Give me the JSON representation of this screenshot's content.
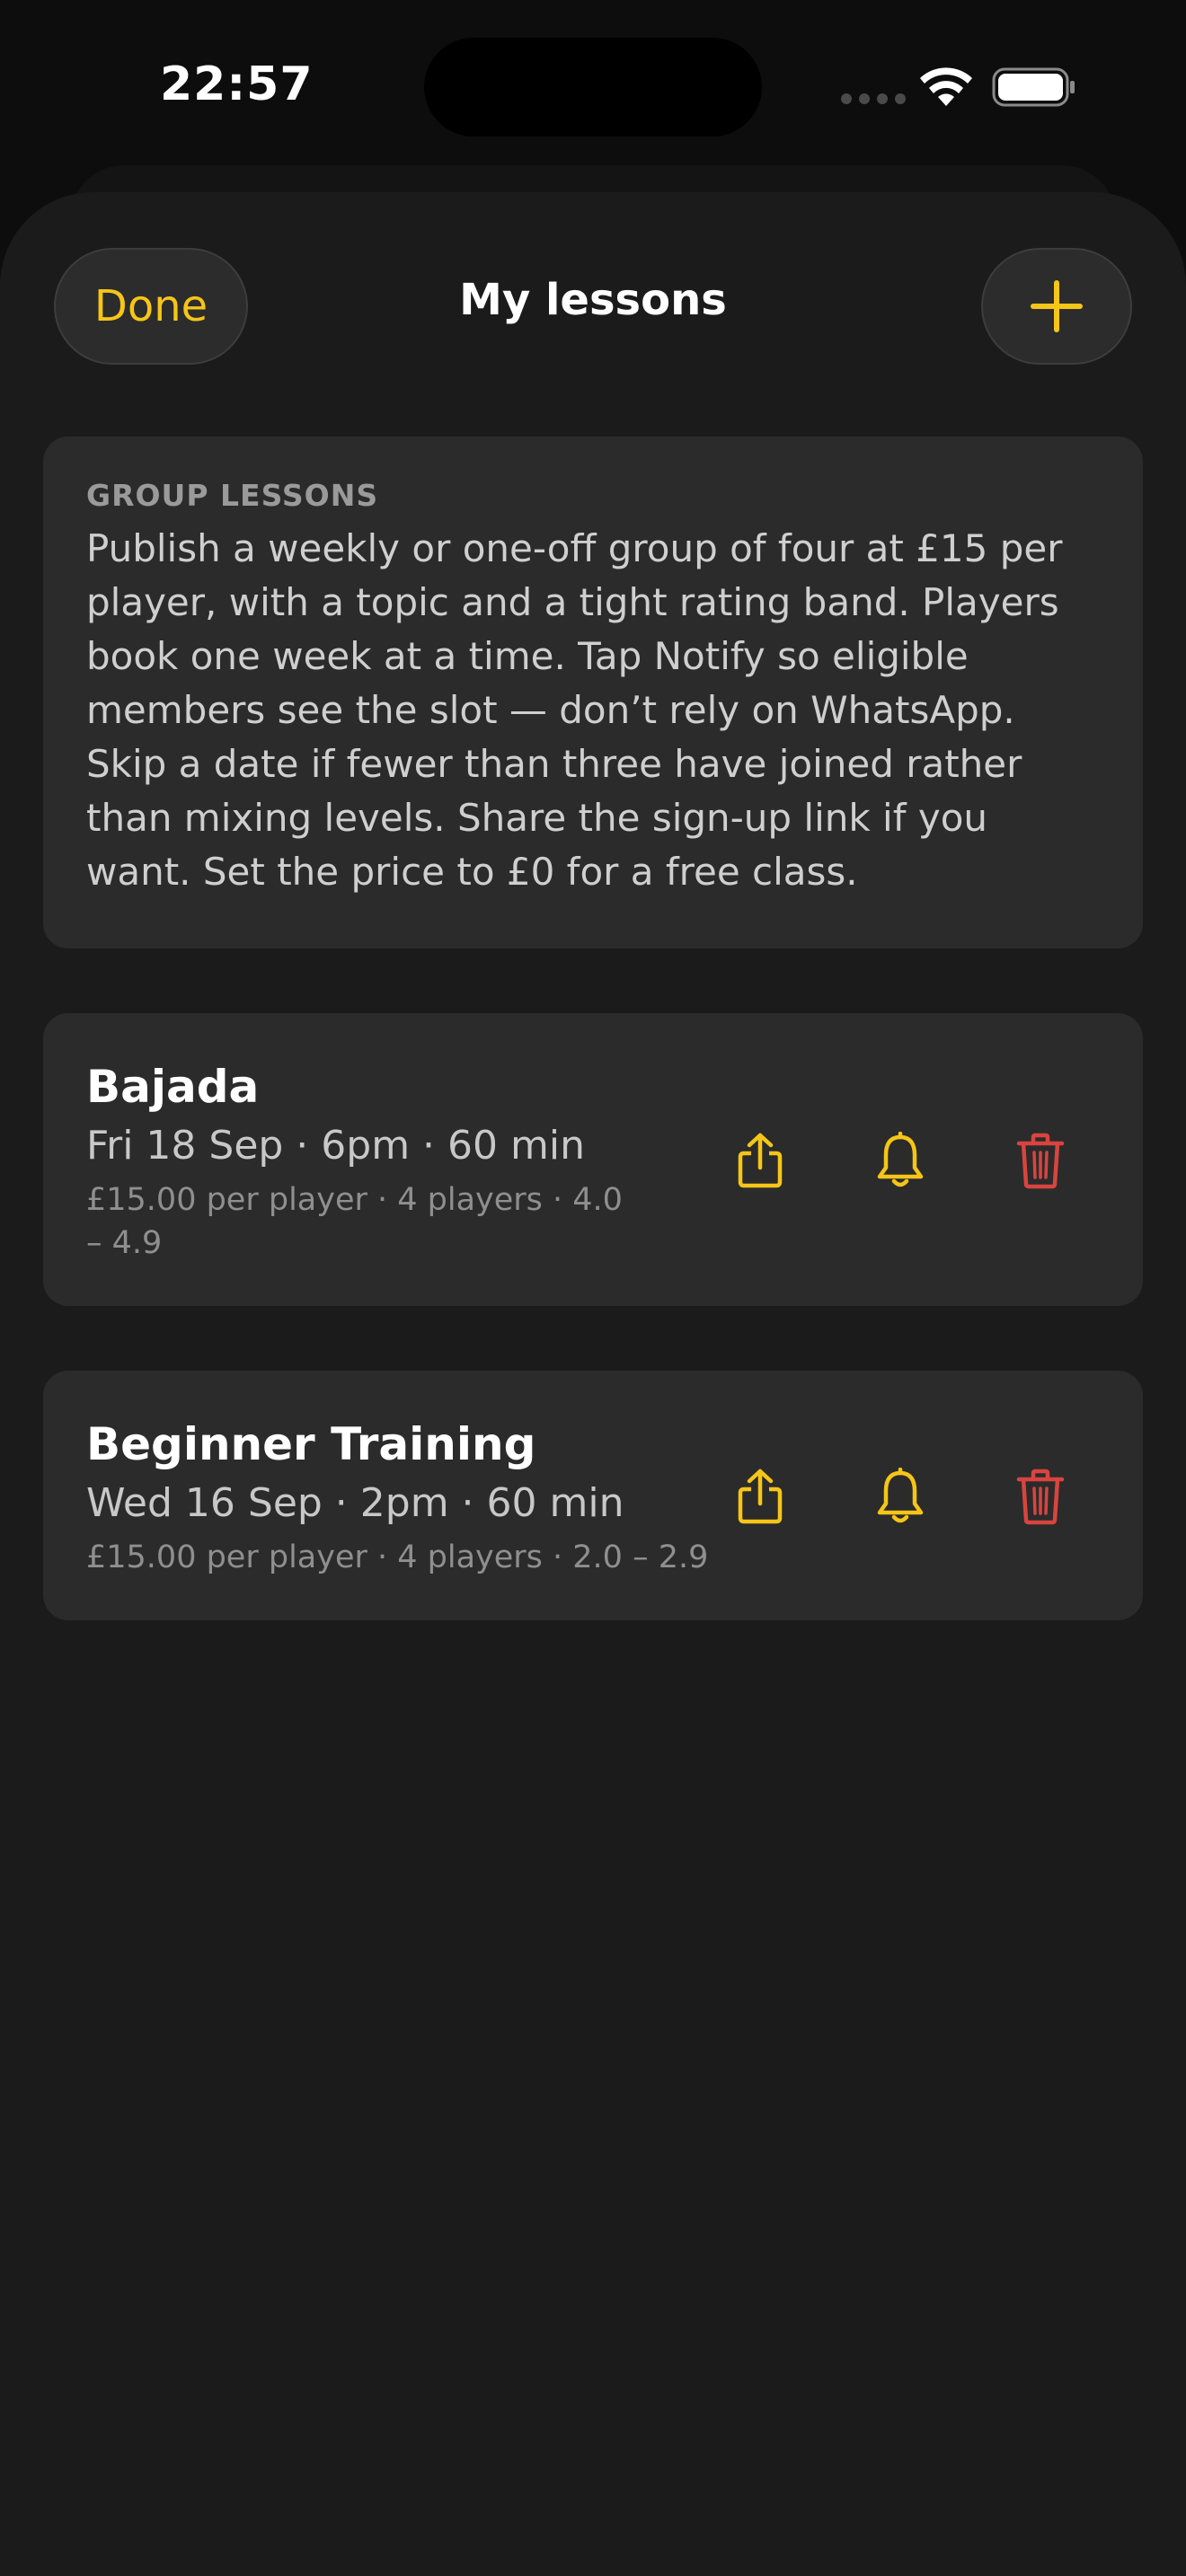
{
  "status_bar": {
    "time": "22:57"
  },
  "nav": {
    "done_label": "Done",
    "title": "My lessons",
    "add_icon": "plus-icon"
  },
  "info": {
    "heading": "GROUP LESSONS",
    "body": "Publish a weekly or one-off group of four at £15 per player, with a topic and a tight rating band. Players book one week at a time. Tap Notify so eligible members see the slot — don’t rely on WhatsApp. Skip a date if fewer than three have joined rather than mixing levels. Share the sign-up link if you want. Set the price to £0 for a free class."
  },
  "lessons": [
    {
      "title": "Bajada",
      "when": "Fri 18 Sep · 6pm · 60 min",
      "meta": "£15.00 per player · 4 players · 4.0 – 4.9"
    },
    {
      "title": "Beginner Training",
      "when": "Wed 16 Sep · 2pm · 60 min",
      "meta": "£15.00 per player · 4 players · 2.0 – 2.9"
    }
  ],
  "icons": {
    "share": "share-icon",
    "notify": "bell-icon",
    "delete": "trash-icon"
  },
  "colors": {
    "accent": "#f5c518",
    "destructive": "#d9443f",
    "background": "#1b1b1b",
    "card": "#2b2b2b"
  }
}
